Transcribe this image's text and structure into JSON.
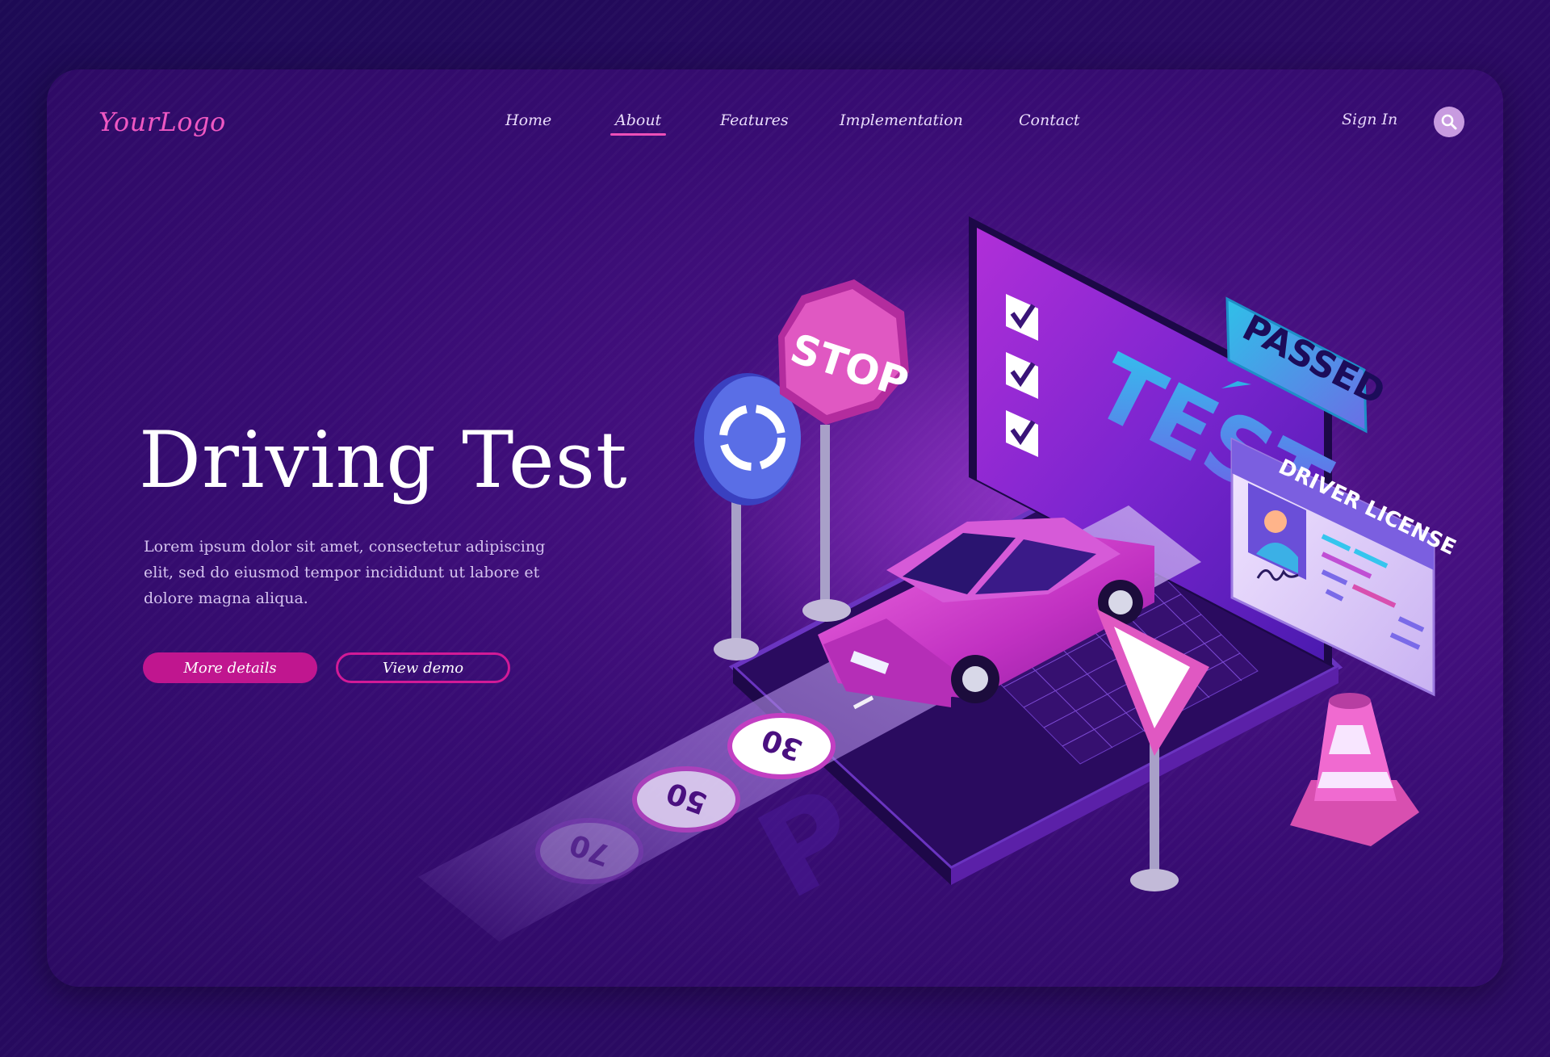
{
  "logo": "YourLogo",
  "nav": {
    "items": [
      {
        "label": "Home",
        "active": false
      },
      {
        "label": "About",
        "active": true
      },
      {
        "label": "Features",
        "active": false
      },
      {
        "label": "Implementation",
        "active": false
      },
      {
        "label": "Contact",
        "active": false
      }
    ],
    "sign_in": "Sign In",
    "search_icon": "search-icon"
  },
  "hero": {
    "title": "Driving Test",
    "description": "Lorem ipsum dolor sit amet, consectetur adipiscing elit, sed do eiusmod tempor incididunt ut labore et dolore magna aliqua.",
    "primary_button": "More details",
    "secondary_button": "View demo"
  },
  "illustration": {
    "stop_sign": "STOP",
    "screen_text": "TEST",
    "passed_bubble": "PASSED",
    "license_title": "DRIVER LICENSE",
    "speed_marks": [
      "30",
      "50",
      "70"
    ],
    "parking_letter": "P"
  },
  "colors": {
    "accent": "#c0168f",
    "logo": "#ef58c2",
    "background": "#22095a",
    "card": "#3b0c74"
  }
}
